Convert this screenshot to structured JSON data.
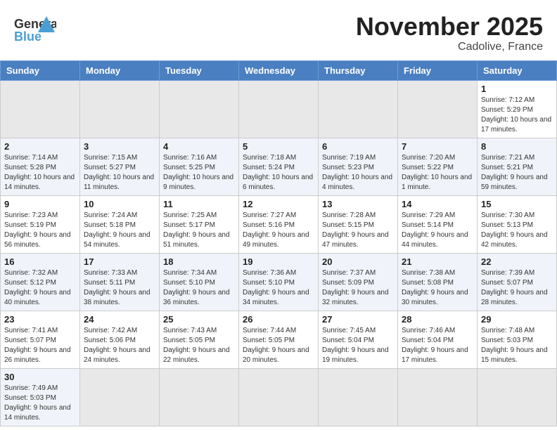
{
  "header": {
    "logo_general": "General",
    "logo_blue": "Blue",
    "month_title": "November 2025",
    "location": "Cadolive, France"
  },
  "days_of_week": [
    "Sunday",
    "Monday",
    "Tuesday",
    "Wednesday",
    "Thursday",
    "Friday",
    "Saturday"
  ],
  "weeks": [
    [
      {
        "day": "",
        "empty": true
      },
      {
        "day": "",
        "empty": true
      },
      {
        "day": "",
        "empty": true
      },
      {
        "day": "",
        "empty": true
      },
      {
        "day": "",
        "empty": true
      },
      {
        "day": "",
        "empty": true
      },
      {
        "day": "1",
        "sunrise": "7:12 AM",
        "sunset": "5:29 PM",
        "daylight": "10 hours and 17 minutes."
      }
    ],
    [
      {
        "day": "2",
        "sunrise": "7:14 AM",
        "sunset": "5:28 PM",
        "daylight": "10 hours and 14 minutes."
      },
      {
        "day": "3",
        "sunrise": "7:15 AM",
        "sunset": "5:27 PM",
        "daylight": "10 hours and 11 minutes."
      },
      {
        "day": "4",
        "sunrise": "7:16 AM",
        "sunset": "5:25 PM",
        "daylight": "10 hours and 9 minutes."
      },
      {
        "day": "5",
        "sunrise": "7:18 AM",
        "sunset": "5:24 PM",
        "daylight": "10 hours and 6 minutes."
      },
      {
        "day": "6",
        "sunrise": "7:19 AM",
        "sunset": "5:23 PM",
        "daylight": "10 hours and 4 minutes."
      },
      {
        "day": "7",
        "sunrise": "7:20 AM",
        "sunset": "5:22 PM",
        "daylight": "10 hours and 1 minute."
      },
      {
        "day": "8",
        "sunrise": "7:21 AM",
        "sunset": "5:21 PM",
        "daylight": "9 hours and 59 minutes."
      }
    ],
    [
      {
        "day": "9",
        "sunrise": "7:23 AM",
        "sunset": "5:19 PM",
        "daylight": "9 hours and 56 minutes."
      },
      {
        "day": "10",
        "sunrise": "7:24 AM",
        "sunset": "5:18 PM",
        "daylight": "9 hours and 54 minutes."
      },
      {
        "day": "11",
        "sunrise": "7:25 AM",
        "sunset": "5:17 PM",
        "daylight": "9 hours and 51 minutes."
      },
      {
        "day": "12",
        "sunrise": "7:27 AM",
        "sunset": "5:16 PM",
        "daylight": "9 hours and 49 minutes."
      },
      {
        "day": "13",
        "sunrise": "7:28 AM",
        "sunset": "5:15 PM",
        "daylight": "9 hours and 47 minutes."
      },
      {
        "day": "14",
        "sunrise": "7:29 AM",
        "sunset": "5:14 PM",
        "daylight": "9 hours and 44 minutes."
      },
      {
        "day": "15",
        "sunrise": "7:30 AM",
        "sunset": "5:13 PM",
        "daylight": "9 hours and 42 minutes."
      }
    ],
    [
      {
        "day": "16",
        "sunrise": "7:32 AM",
        "sunset": "5:12 PM",
        "daylight": "9 hours and 40 minutes."
      },
      {
        "day": "17",
        "sunrise": "7:33 AM",
        "sunset": "5:11 PM",
        "daylight": "9 hours and 38 minutes."
      },
      {
        "day": "18",
        "sunrise": "7:34 AM",
        "sunset": "5:10 PM",
        "daylight": "9 hours and 36 minutes."
      },
      {
        "day": "19",
        "sunrise": "7:36 AM",
        "sunset": "5:10 PM",
        "daylight": "9 hours and 34 minutes."
      },
      {
        "day": "20",
        "sunrise": "7:37 AM",
        "sunset": "5:09 PM",
        "daylight": "9 hours and 32 minutes."
      },
      {
        "day": "21",
        "sunrise": "7:38 AM",
        "sunset": "5:08 PM",
        "daylight": "9 hours and 30 minutes."
      },
      {
        "day": "22",
        "sunrise": "7:39 AM",
        "sunset": "5:07 PM",
        "daylight": "9 hours and 28 minutes."
      }
    ],
    [
      {
        "day": "23",
        "sunrise": "7:41 AM",
        "sunset": "5:07 PM",
        "daylight": "9 hours and 26 minutes."
      },
      {
        "day": "24",
        "sunrise": "7:42 AM",
        "sunset": "5:06 PM",
        "daylight": "9 hours and 24 minutes."
      },
      {
        "day": "25",
        "sunrise": "7:43 AM",
        "sunset": "5:05 PM",
        "daylight": "9 hours and 22 minutes."
      },
      {
        "day": "26",
        "sunrise": "7:44 AM",
        "sunset": "5:05 PM",
        "daylight": "9 hours and 20 minutes."
      },
      {
        "day": "27",
        "sunrise": "7:45 AM",
        "sunset": "5:04 PM",
        "daylight": "9 hours and 19 minutes."
      },
      {
        "day": "28",
        "sunrise": "7:46 AM",
        "sunset": "5:04 PM",
        "daylight": "9 hours and 17 minutes."
      },
      {
        "day": "29",
        "sunrise": "7:48 AM",
        "sunset": "5:03 PM",
        "daylight": "9 hours and 15 minutes."
      }
    ],
    [
      {
        "day": "30",
        "sunrise": "7:49 AM",
        "sunset": "5:03 PM",
        "daylight": "9 hours and 14 minutes."
      },
      {
        "day": "",
        "empty": true
      },
      {
        "day": "",
        "empty": true
      },
      {
        "day": "",
        "empty": true
      },
      {
        "day": "",
        "empty": true
      },
      {
        "day": "",
        "empty": true
      },
      {
        "day": "",
        "empty": true
      }
    ]
  ]
}
